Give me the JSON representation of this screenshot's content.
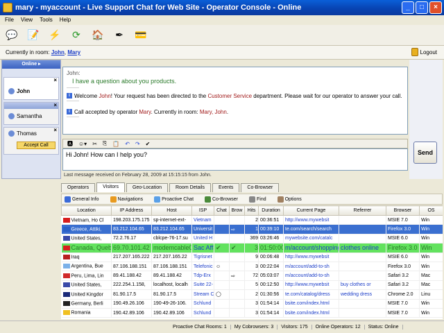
{
  "window": {
    "title": "mary - myaccount - Live Support Chat for Web Site - Operator Console - Online"
  },
  "menu": [
    "File",
    "View",
    "Tools",
    "Help"
  ],
  "toolbar_icons": [
    "chat-icon",
    "edit-icon",
    "flash-icon",
    "refresh-icon",
    "home-icon",
    "pen-icon",
    "card-icon"
  ],
  "room": {
    "prefix": "Currently in room:",
    "user1": "John",
    "sep": ",",
    "user2": "Mary",
    "logout": "Logout"
  },
  "left": {
    "header": "Online",
    "visitors": [
      {
        "name": "John"
      },
      {
        "name": "Samantha"
      },
      {
        "name": "Thomas",
        "accept": "Accept Call"
      }
    ]
  },
  "chat": {
    "visitor_label": "John:",
    "visitor_msg": "I have a question about you products.",
    "sys1_a": "Welcome ",
    "sys1_name": "John",
    "sys1_b": "! Your request has been directed to the ",
    "sys1_dept": "Customer Service",
    "sys1_c": " department.  Please wait for our operator to answer your call.",
    "sys2_a": "Call accepted by operator ",
    "sys2_op": "Mary",
    "sys2_b": ". Currently in room: ",
    "sys2_room": "Mary, John",
    "sys2_c": ".",
    "input": "Hi John! How can I help you?",
    "send": "Send",
    "last_msg": "Last message received on February 28, 2009 at 15:15:15 from John."
  },
  "tabs": [
    "Operators",
    "Visitors",
    "Geo-Location",
    "Room Details",
    "Events",
    "Co-Browser"
  ],
  "subtools": [
    "General Info",
    "Navigations",
    "Proactive Chat",
    "Co-Browser",
    "Find",
    "Options"
  ],
  "columns": [
    "Location",
    "IP Address",
    "Host",
    "ISP",
    "Chat",
    "Brow",
    "Hits",
    "Duration",
    "Current Page",
    "Referrer",
    "Browser",
    "OS"
  ],
  "rows": [
    {
      "flag": "#d81e1e",
      "loc": "Vietnam, Ho Cl",
      "ip": "198.203.175.175",
      "host": "sp-internet-ext-",
      "isp": "Vietnam",
      "chat": "",
      "brow": "",
      "hits": "2",
      "dur": "00:36:51",
      "page": "http://www.mywebsit",
      "ref": "",
      "browser": "MSIE 7.0",
      "os": "Win"
    },
    {
      "flag": "#2a60c8",
      "loc": "Greece, Attiki,",
      "ip": "83.212.104.65",
      "host": "83.212.104.65",
      "isp": "Universit",
      "chat": "",
      "brow": "⇨",
      "hits": "1",
      "dur": "00:39:10",
      "page": "te.com/search/search",
      "ref": "",
      "browser": "Firefox 3.0",
      "os": "Win",
      "sel": true
    },
    {
      "flag": "#3a4aa8",
      "loc": "United States,",
      "ip": "72.2.76.17",
      "host": "cblcpe-76-17.su",
      "isp": "United H",
      "chat": "",
      "brow": "",
      "hits": "369",
      "dur": "03:26:46",
      "page": "mywebsite.com/catalc",
      "ref": "",
      "browser": "MSIE 6.0",
      "os": "Win"
    },
    {
      "flag": "#d81e1e",
      "loc": "Canada, Queb",
      "ip": "69.70.101.42",
      "host": "modemcable042",
      "isp": "Sac Affa",
      "chat": "✔",
      "brow": "✔",
      "hits": "3",
      "dur": "01:50:00",
      "page": "m/account/shopping-",
      "ref": "clothes online",
      "browser": "Firefox 3.0",
      "os": "Win",
      "green": true
    },
    {
      "flag": "#b82020",
      "loc": "Iraq",
      "ip": "217.207.165.222",
      "host": "217.207.165.22",
      "isp": "Tigrisnet",
      "chat": "",
      "brow": "",
      "hits": "9",
      "dur": "00:06:48",
      "page": "http://www.mywebsit",
      "ref": "",
      "browser": "MSIE 6.0",
      "os": "Win"
    },
    {
      "flag": "#7ab0e8",
      "loc": "Argentina, Bue",
      "ip": "87.106.188.151",
      "host": "87.106.188.151",
      "isp": "Telefonic",
      "chat": "☺",
      "brow": "",
      "hits": "3",
      "dur": "00:22:04",
      "page": "m/account/add-to-sh",
      "ref": "",
      "browser": "Firefox 3.0",
      "os": "Win"
    },
    {
      "flag": "#d02a2a",
      "loc": "Peru, Lima, Lin",
      "ip": "89.41.188.42",
      "host": "89.41.188.42",
      "isp": "Tdp-Erx",
      "chat": "",
      "brow": "⇨",
      "hits": "72",
      "dur": "05:03:07",
      "page": "m/account/add-to-sh",
      "ref": "",
      "browser": "Safari 3.2",
      "os": "Mac"
    },
    {
      "flag": "#3a4aa8",
      "loc": "United States,",
      "ip": "222.254.1.158,",
      "host": "localhost, localh",
      "isp": "Suite 22-",
      "chat": "",
      "brow": "",
      "hits": "5",
      "dur": "00:12:50",
      "page": "http://www.mywebsit",
      "ref": "buy clothes or",
      "browser": "Safari 3.2",
      "os": "Mac"
    },
    {
      "flag": "#1a2a78",
      "loc": "United Kingdor",
      "ip": "81.90.17.5",
      "host": "81.90.17.5",
      "isp": "Stream C",
      "chat": "◯",
      "brow": "",
      "hits": "2",
      "dur": "01:30:56",
      "page": "te.com/catalog/dress",
      "ref": "wedding dress",
      "browser": "Chrome 2.0",
      "os": "Linu"
    },
    {
      "flag": "#222222",
      "loc": "Germany, Berli",
      "ip": "190.49.26.106",
      "host": "190-49-26-106.",
      "isp": "Schlund",
      "chat": "",
      "brow": "",
      "hits": "3",
      "dur": "01:54:14",
      "page": "bsite.com/index.html",
      "ref": "",
      "browser": "MSIE 7.0",
      "os": "Win"
    },
    {
      "flag": "#f0c020",
      "loc": "Romania",
      "ip": "190.42.89.106",
      "host": "190.42.89.106",
      "isp": "Schlund",
      "chat": "",
      "brow": "",
      "hits": "3",
      "dur": "01:54:14",
      "page": "bsite.com/index.html",
      "ref": "",
      "browser": "MSIE 7.0",
      "os": "Win"
    }
  ],
  "status": [
    "Proactive Chat Rooms: 1",
    "My Cobrowsers: 3",
    "Visitors: 175",
    "Online Operators: 12",
    "Status: Online"
  ]
}
